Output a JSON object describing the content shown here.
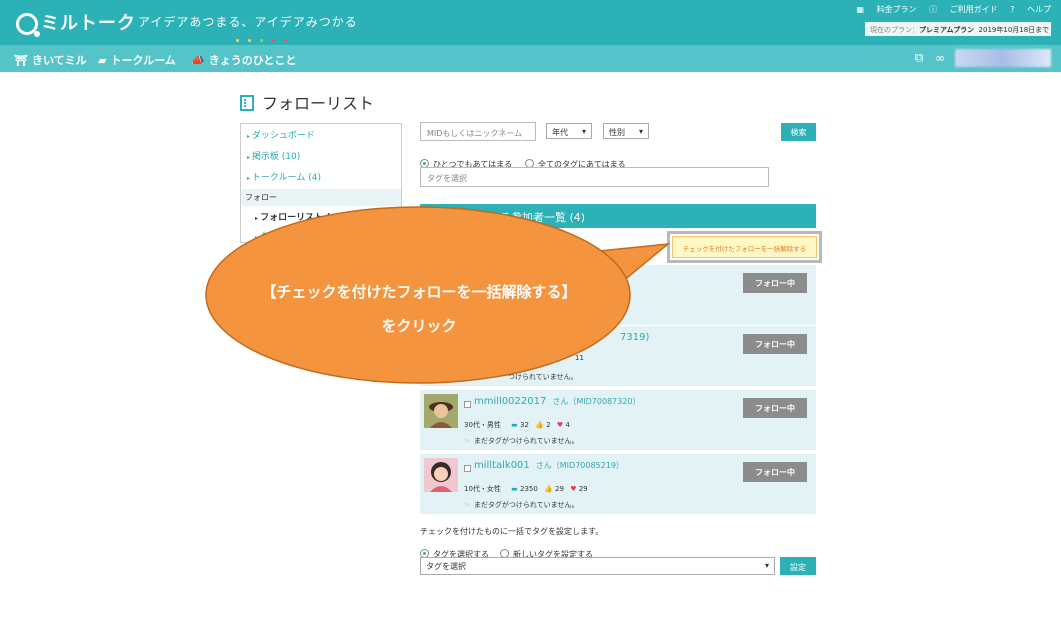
{
  "header": {
    "logo_text": "ミルトーク",
    "tagline": "アイデアあつまる、アイデアみつかる",
    "dot_colors": [
      "#f6d84a",
      "#f6d84a",
      "#8bd36a",
      "#e84a7a",
      "#e84a7a"
    ],
    "links": [
      "料金プラン",
      "ご利用ガイド",
      "ヘルプ"
    ],
    "link_icons": [
      "calendar-icon",
      "info-icon",
      "question-icon"
    ],
    "plan_label": "現在のプラン：",
    "plan_name": "プレミアムプラン",
    "plan_expiry": "2019年10月18日まで",
    "bg_color": "#2cb1b6"
  },
  "nav": {
    "items": [
      {
        "label": "きいてミル",
        "icon": "board-icon"
      },
      {
        "label": "トークルーム",
        "icon": "chat-icon"
      },
      {
        "label": "きょうのひとこと",
        "icon": "megaphone-icon"
      }
    ],
    "right_icons": [
      "message-icon",
      "chat-bubbles-icon"
    ],
    "bg_color": "#55c4c8"
  },
  "page": {
    "title": "フォローリスト"
  },
  "sidebar": {
    "items": [
      "ダッシュボード",
      "掲示板 (10)",
      "トークルーム (4)"
    ],
    "section": "フォロー",
    "sub_items": [
      "フォローリスト (4)",
      "タグ管理"
    ]
  },
  "search": {
    "mid_placeholder": "MIDもしくはニックネーム",
    "age_select": "年代",
    "gender_select": "性別",
    "search_button": "検索",
    "radio_any": "ひとつでもあてはまる",
    "radio_all": "全てのタグにあてはまる",
    "tag_placeholder": "タグを選択"
  },
  "list": {
    "header_title": "る参加者一覧 (4)",
    "bulk_unfollow_button": "チェックを付けたフォローを一括解除する",
    "rows": [
      {
        "name": "",
        "mid": "",
        "meta": "",
        "comments": "",
        "thumbs": "",
        "hearts": "",
        "tags": "",
        "follow_label": "フォロー中"
      },
      {
        "name": "",
        "mid": "7319)",
        "meta": "",
        "comments": "",
        "thumbs": "",
        "hearts": "11",
        "tags": "つけられていません。",
        "follow_label": "フォロー中"
      },
      {
        "name": "mmill0022017",
        "mid": "さん（MID70087320）",
        "meta": "30代・男性",
        "comments": "32",
        "thumbs": "2",
        "hearts": "4",
        "tags": "まだタグがつけられていません。",
        "follow_label": "フォロー中"
      },
      {
        "name": "milltalk001",
        "mid": "さん（MID70085219）",
        "meta": "10代・女性",
        "comments": "2350",
        "thumbs": "29",
        "hearts": "29",
        "tags": "まだタグがつけられていません。",
        "follow_label": "フォロー中"
      }
    ]
  },
  "bulk_tag": {
    "description": "チェックを付けたものに一括でタグを設定します。",
    "radio_select": "タグを選択する",
    "radio_new": "新しいタグを設定する",
    "select_value": "タグを選択",
    "set_button": "設定"
  },
  "callout": {
    "line1": "【チェックを付けたフォローを一括解除する】",
    "line2": "をクリック",
    "fill_color": "#f5943f"
  }
}
